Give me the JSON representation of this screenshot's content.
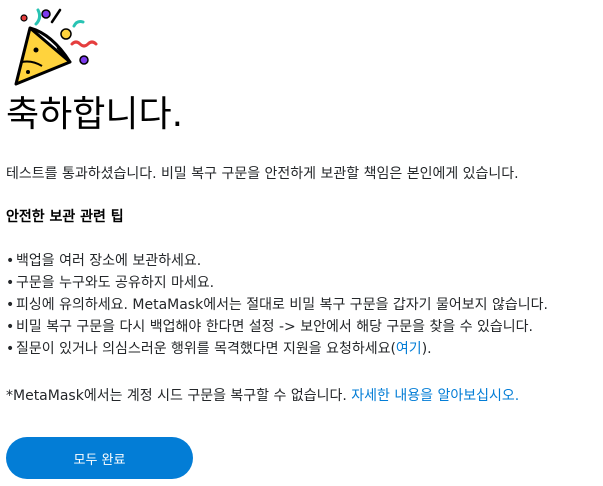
{
  "icon": "party-popper-icon",
  "title": "축하합니다.",
  "intro": "테스트를 통과하셨습니다. 비밀 복구 구문을 안전하게 보관할 책임은 본인에게 있습니다.",
  "tips_heading": "안전한 보관 관련 팁",
  "tips": [
    {
      "text": "백업을 여러 장소에 보관하세요."
    },
    {
      "text": "구문을 누구와도 공유하지 마세요."
    },
    {
      "text": "피싱에 유의하세요. MetaMask에서는 절대로 비밀 복구 구문을 갑자기 물어보지 않습니다."
    },
    {
      "text": "비밀 복구 구문을 다시 백업해야 한다면 설정 -> 보안에서 해당 구문을 찾을 수 있습니다."
    },
    {
      "text_before": "질문이 있거나 의심스러운 행위를 목격했다면 지원을 요청하세요(",
      "link": "여기",
      "text_after": ")."
    }
  ],
  "note": {
    "text": "*MetaMask에서는 계정 시드 구문을 복구할 수 없습니다.",
    "link": "자세한 내용을 알아보십시오."
  },
  "done_button": "모두 완료",
  "colors": {
    "accent": "#037dd6",
    "text": "#24272a",
    "confetti_yellow": "#ffd33d",
    "confetti_purple": "#7c3aed",
    "confetti_teal": "#28c3b3",
    "confetti_red": "#e53e3e"
  }
}
